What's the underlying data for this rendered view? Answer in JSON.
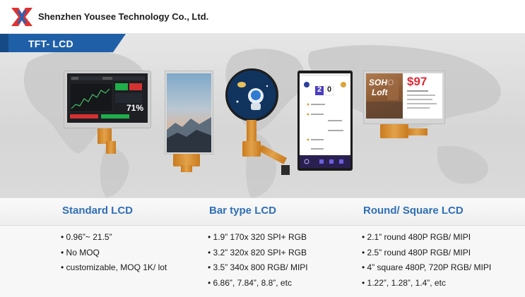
{
  "header": {
    "company": "Shenzhen Yousee Technology Co., Ltd.",
    "logo_icon": "yousee-logo-icon"
  },
  "banner": {
    "title": "TFT- LCD"
  },
  "colors": {
    "accent_blue": "#2f6fb6",
    "title_bar": "#1f5fa8",
    "cable_orange": "#d48a2e"
  },
  "products": {
    "dashboard": {
      "price_pct": "71%"
    },
    "round": {},
    "phone": {
      "score_left": "2",
      "score_right": "0"
    },
    "square": {
      "brand_line1": "SOHO",
      "brand_line2": "Loft",
      "price": "$97"
    }
  },
  "columns": [
    {
      "title": "Standard LCD",
      "items": [
        "0.96”~ 21.5”",
        "No MOQ",
        "customizable, MOQ 1K/ lot"
      ]
    },
    {
      "title": "Bar type LCD",
      "items": [
        "1.9” 170x 320 SPI+ RGB",
        "3.2” 320x 820 SPI+ RGB",
        "3.5” 340x 800 RGB/ MIPI",
        "6.86”, 7.84”, 8.8”, etc"
      ]
    },
    {
      "title": "Round/ Square LCD",
      "items": [
        "2.1” round 480P RGB/ MIPI",
        "2.5” round 480P RGB/ MIPI",
        "4” square 480P, 720P RGB/ MIPI",
        "1.22”, 1.28”, 1.4”, etc"
      ]
    }
  ]
}
